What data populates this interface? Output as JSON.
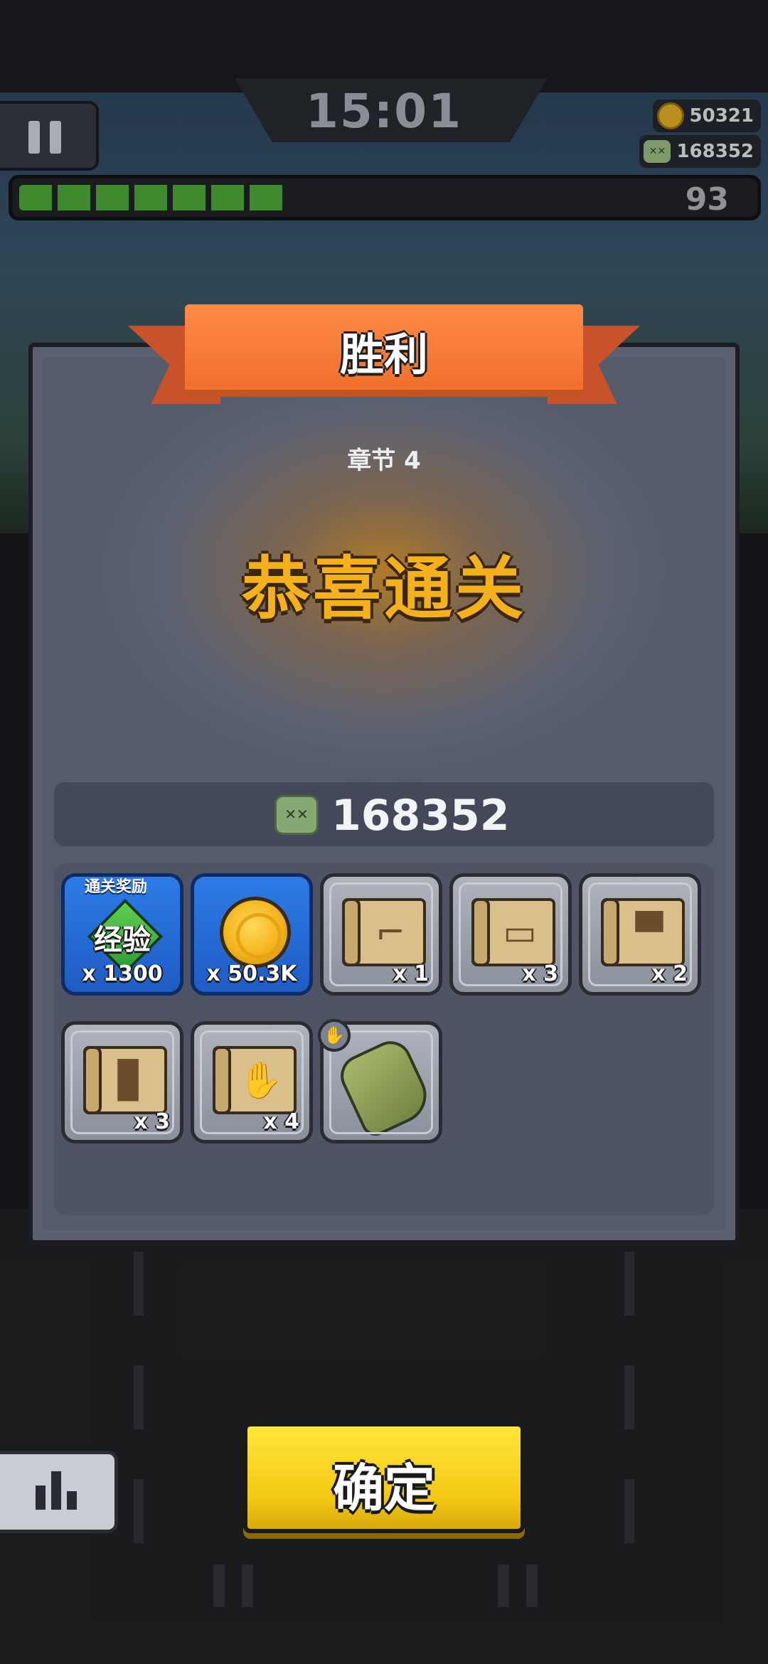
{
  "hud": {
    "timer": "15:01",
    "coins": "50321",
    "kills": "168352",
    "level": "93",
    "xp_progress": 0.36
  },
  "dialog": {
    "title": "胜利",
    "chapter": "章节 4",
    "headline": "恭喜通关",
    "kill_total": "168352",
    "reward_badge": "通关奖励",
    "rewards": [
      {
        "type": "exp",
        "icon": "exp-diamond-icon",
        "label": "经验",
        "qty": "x 1300"
      },
      {
        "type": "coin",
        "icon": "gold-coin-icon",
        "qty": "x 50.3K"
      },
      {
        "type": "blueprint",
        "icon": "pistol-blueprint-icon",
        "qty": "x 1"
      },
      {
        "type": "blueprint",
        "icon": "belt-blueprint-icon",
        "qty": "x 3"
      },
      {
        "type": "blueprint",
        "icon": "armor-blueprint-icon",
        "qty": "x 2"
      },
      {
        "type": "blueprint",
        "icon": "pants-blueprint-icon",
        "qty": "x 3"
      },
      {
        "type": "blueprint",
        "icon": "glove-blueprint-icon",
        "qty": "x 4"
      },
      {
        "type": "equipment",
        "icon": "tactical-glove-icon",
        "qty": ""
      }
    ]
  },
  "buttons": {
    "confirm": "确定"
  },
  "colors": {
    "ribbon": "#f0702c",
    "headline": "#f4b11c",
    "confirm": "#f3c814",
    "reward_blue": "#2d7be6",
    "xp_green": "#3f8a2e"
  }
}
